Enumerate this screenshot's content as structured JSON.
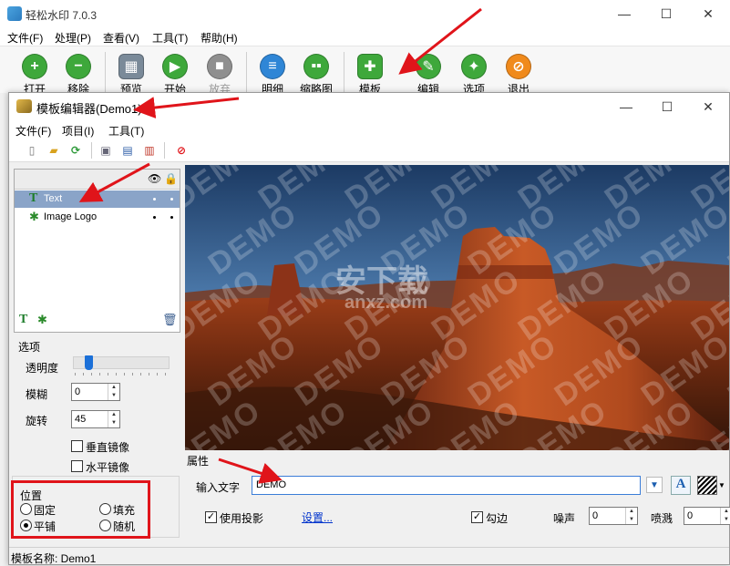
{
  "main_window": {
    "title": "轻松水印 7.0.3",
    "controls": [
      "—",
      "☐",
      "✕"
    ],
    "menu": [
      "文件(F)",
      "处理(P)",
      "查看(V)",
      "工具(T)",
      "帮助(H)"
    ],
    "toolbar": [
      {
        "label": "打开",
        "icon": "plus-icon",
        "color": "#3ea83b"
      },
      {
        "label": "移除",
        "icon": "minus-icon",
        "color": "#3ea83b"
      },
      {
        "label": "预览",
        "icon": "preview-icon",
        "color": "#7a8a99"
      },
      {
        "label": "开始",
        "icon": "play-icon",
        "color": "#3ea83b"
      },
      {
        "label": "放弃",
        "icon": "stop-icon",
        "color": "#8f8f8f"
      },
      {
        "label": "明细",
        "icon": "details-icon",
        "color": "#2f86d6"
      },
      {
        "label": "缩略图",
        "icon": "thumbnails-icon",
        "color": "#3ea83b"
      },
      {
        "label": "模板",
        "icon": "puzzle-icon",
        "color": "#3ea83b"
      },
      {
        "label": "编辑",
        "icon": "pencil-icon",
        "color": "#3ea83b"
      },
      {
        "label": "选项",
        "icon": "wrench-icon",
        "color": "#3ea83b"
      },
      {
        "label": "退出",
        "icon": "exit-icon",
        "color": "#f08a1c"
      }
    ]
  },
  "editor": {
    "title": "模板编辑器(Demo1)",
    "controls": [
      "—",
      "☐",
      "✕"
    ],
    "menu": [
      "文件(F)",
      "项目(I)",
      "工具(T)"
    ],
    "layers": [
      {
        "name": "Text",
        "icon": "text-layer-icon",
        "selected": true
      },
      {
        "name": "Image Logo",
        "icon": "image-layer-icon",
        "selected": false
      }
    ],
    "options": {
      "section_title": "选项",
      "opacity_label": "透明度",
      "opacity_value": 0.12,
      "blur_label": "模糊",
      "blur_value": "0",
      "rotate_label": "旋转",
      "rotate_value": "45",
      "flip_vertical_label": "垂直镜像",
      "flip_horizontal_label": "水平镜像"
    },
    "position": {
      "section_title": "位置",
      "fixed": "固定",
      "fill": "填充",
      "tile": "平铺",
      "random": "随机",
      "selected": "平铺"
    },
    "preview": {
      "watermark_text": "DEMO",
      "site_watermark": "安下载",
      "site_watermark_sub": "anxz.com"
    },
    "properties": {
      "section_title": "属性",
      "input_label": "输入文字",
      "input_value": "DEMO",
      "shadow_label": "使用投影",
      "shadow_checked": true,
      "settings_link": "设置...",
      "outline_label": "勾边",
      "outline_checked": true,
      "noise_label": "噪声",
      "noise_value": "0",
      "spray_label": "喷溅",
      "spray_value": "0"
    },
    "status": "模板名称:  Demo1"
  },
  "colors": {
    "accent_red": "#e0141a",
    "selection": "#8aa4c8",
    "link": "#0033cc"
  }
}
